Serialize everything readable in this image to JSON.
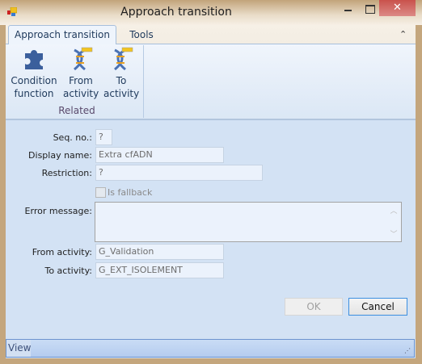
{
  "window": {
    "title": "Approach transition",
    "close_glyph": "✕"
  },
  "tabs": [
    {
      "label": "Approach transition",
      "active": true
    },
    {
      "label": "Tools",
      "active": false
    }
  ],
  "ribbon": {
    "buttons": [
      {
        "line1": "Condition",
        "line2": "function",
        "icon": "puzzle-icon"
      },
      {
        "line1": "From",
        "line2": "activity",
        "icon": "dna-activity-icon"
      },
      {
        "line1": "To",
        "line2": "activity",
        "icon": "dna-activity-icon"
      }
    ],
    "group_label": "Related",
    "collapse_glyph": "⌃"
  },
  "form": {
    "seq_label": "Seq. no.:",
    "seq_value": "?",
    "display_label": "Display name:",
    "display_value": "Extra cfADN",
    "restriction_label": "Restriction:",
    "restriction_value": "?",
    "fallback_label": "Is fallback",
    "fallback_checked": false,
    "error_label": "Error message:",
    "error_value": "",
    "from_label": "From activity:",
    "from_value": "G_Validation",
    "to_label": "To activity:",
    "to_value": "G_EXT_ISOLEMENT"
  },
  "buttons": {
    "ok": "OK",
    "cancel": "Cancel"
  },
  "status": {
    "view": "View"
  }
}
